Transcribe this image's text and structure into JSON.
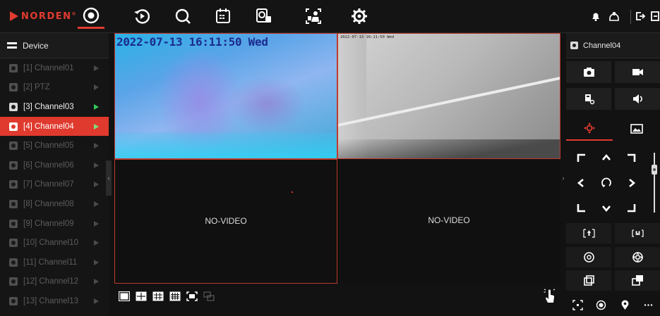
{
  "brand": {
    "name": "NORDEN",
    "mark": "®",
    "accent": "#e23b30"
  },
  "nav": {
    "items": [
      {
        "name": "live-view",
        "icon": "target-icon",
        "active": true
      },
      {
        "name": "playback",
        "icon": "playback-icon"
      },
      {
        "name": "search",
        "icon": "search-icon"
      },
      {
        "name": "schedule",
        "icon": "calendar-icon"
      },
      {
        "name": "ai",
        "icon": "ai-camera-icon"
      },
      {
        "name": "face",
        "icon": "face-detect-icon"
      },
      {
        "name": "settings",
        "icon": "gear-icon"
      }
    ],
    "right": [
      "bell-icon",
      "user-icon",
      "logout-icon",
      "exit-icon"
    ]
  },
  "sidebar": {
    "header": "Device",
    "channels": [
      {
        "label": "[1] Channel01",
        "state": "off"
      },
      {
        "label": "[2] PTZ",
        "state": "off"
      },
      {
        "label": "[3] Channel03",
        "state": "live"
      },
      {
        "label": "[4] Channel04",
        "state": "selected"
      },
      {
        "label": "[5] Channel05",
        "state": "off"
      },
      {
        "label": "[6] Channel06",
        "state": "off"
      },
      {
        "label": "[7] Channel07",
        "state": "off"
      },
      {
        "label": "[8] Channel08",
        "state": "off"
      },
      {
        "label": "[9] Channel09",
        "state": "off"
      },
      {
        "label": "[10] Channel10",
        "state": "off"
      },
      {
        "label": "[11] Channel11",
        "state": "off"
      },
      {
        "label": "[12] Channel12",
        "state": "off"
      },
      {
        "label": "[13] Channel13",
        "state": "off"
      }
    ]
  },
  "video": {
    "tile1_timestamp": "2022-07-13 16:11:50 Wed",
    "tile2_timestamp": "2022-07-13 16:11:50 Wed",
    "no_video": "NO-VIDEO"
  },
  "panel": {
    "channel": "Channel04"
  },
  "colors": {
    "selected_bg": "#e03a2e",
    "live_play": "#34c759"
  }
}
